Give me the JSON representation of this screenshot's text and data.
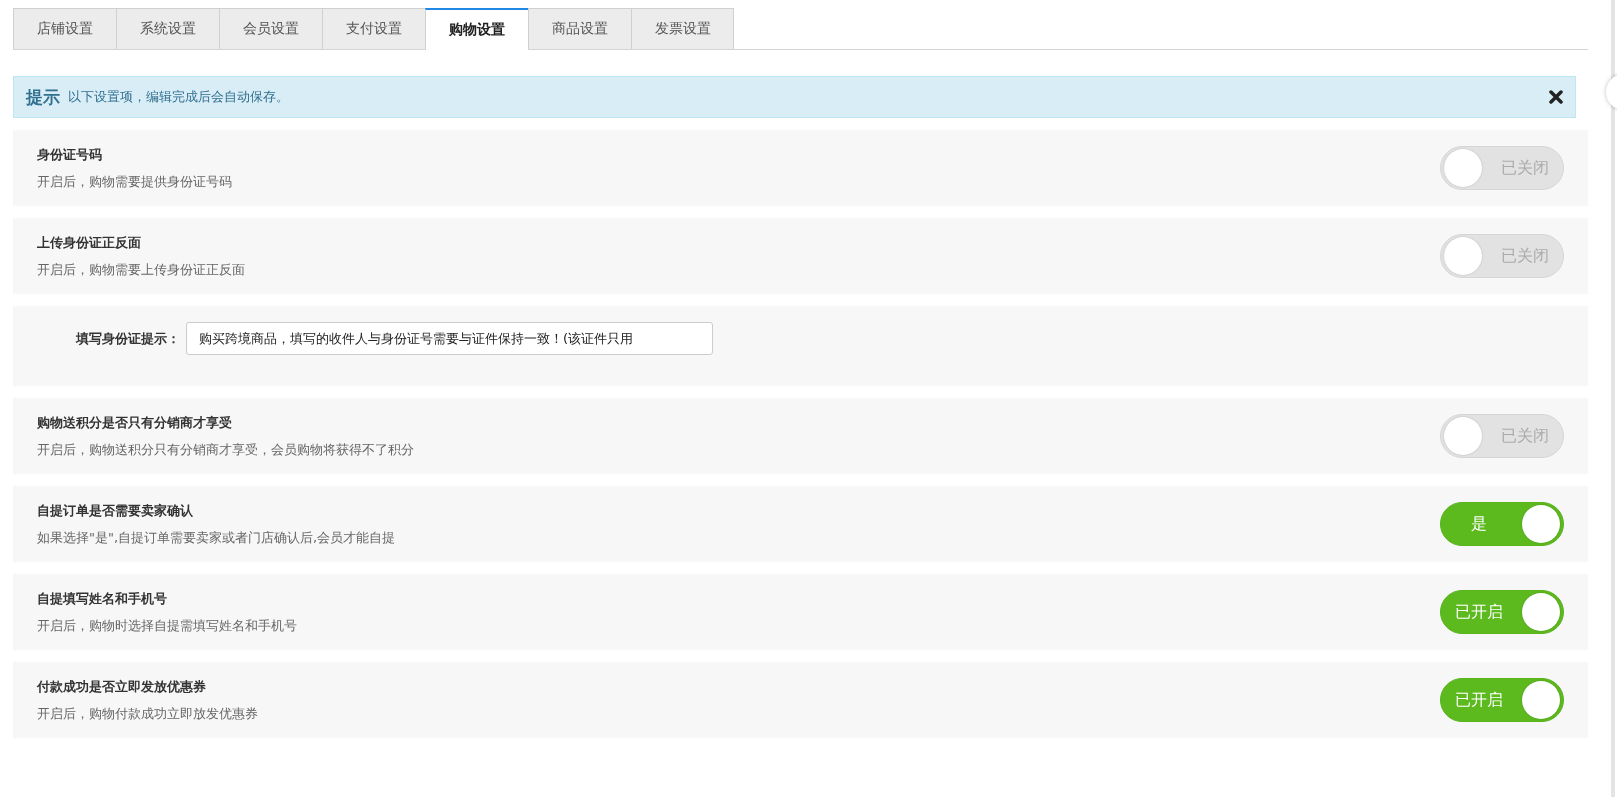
{
  "tabs": [
    {
      "label": "店铺设置",
      "selected": false
    },
    {
      "label": "系统设置",
      "selected": false
    },
    {
      "label": "会员设置",
      "selected": false
    },
    {
      "label": "支付设置",
      "selected": false
    },
    {
      "label": "购物设置",
      "selected": true
    },
    {
      "label": "商品设置",
      "selected": false
    },
    {
      "label": "发票设置",
      "selected": false
    }
  ],
  "tip": {
    "title": "提示",
    "text": "以下设置项，编辑完成后会自动保存。"
  },
  "settings": [
    {
      "kind": "toggle",
      "title": "身份证号码",
      "description": "开启后，购物需要提供身份证号码",
      "on": false,
      "switch_label": "已关闭"
    },
    {
      "kind": "toggle",
      "title": "上传身份证正反面",
      "description": "开启后，购物需要上传身份证正反面",
      "on": false,
      "switch_label": "已关闭"
    },
    {
      "kind": "field",
      "label": "填写身份证提示：",
      "value": "购买跨境商品，填写的收件人与身份证号需要与证件保持一致！(该证件只用"
    },
    {
      "kind": "toggle",
      "title": "购物送积分是否只有分销商才享受",
      "description": "开启后，购物送积分只有分销商才享受，会员购物将获得不了积分",
      "on": false,
      "switch_label": "已关闭"
    },
    {
      "kind": "toggle",
      "title": "自提订单是否需要卖家确认",
      "description": "如果选择\"是\",自提订单需要卖家或者门店确认后,会员才能自提",
      "on": true,
      "switch_label": "是"
    },
    {
      "kind": "toggle",
      "title": "自提填写姓名和手机号",
      "description": "开启后，购物时选择自提需填写姓名和手机号",
      "on": true,
      "switch_label": "已开启"
    },
    {
      "kind": "toggle",
      "title": "付款成功是否立即发放优惠券",
      "description": "开启后，购物付款成功立即放发优惠券",
      "on": true,
      "switch_label": "已开启"
    }
  ]
}
